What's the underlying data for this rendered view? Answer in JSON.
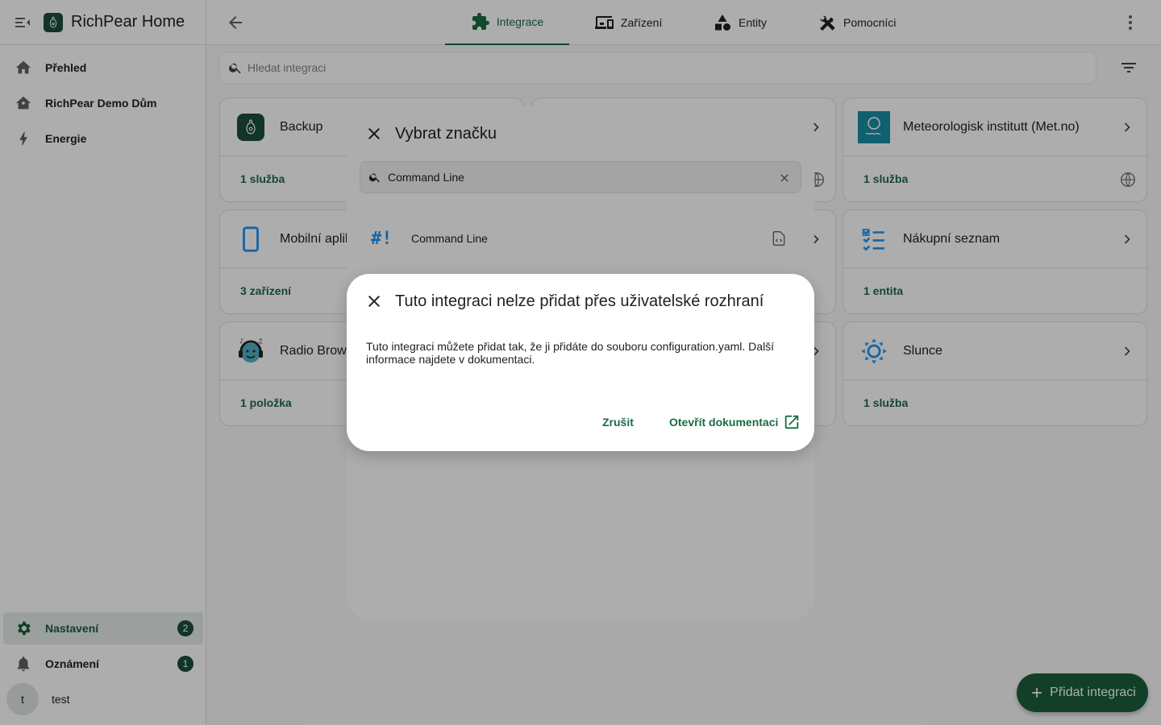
{
  "app": {
    "title": "RichPear Home"
  },
  "sidebar": {
    "items": [
      {
        "label": "Přehled",
        "icon": "home-icon"
      },
      {
        "label": "RichPear Demo Dům",
        "icon": "home-outline-icon"
      },
      {
        "label": "Energie",
        "icon": "lightning-icon"
      }
    ],
    "bottom": [
      {
        "label": "Nastavení",
        "icon": "gear-icon",
        "badge": "2"
      },
      {
        "label": "Oznámení",
        "icon": "bell-icon",
        "badge": "1"
      }
    ],
    "user": {
      "initial": "t",
      "name": "test"
    }
  },
  "tabs": [
    {
      "label": "Integrace",
      "icon": "puzzle-icon"
    },
    {
      "label": "Zařízení",
      "icon": "devices-icon"
    },
    {
      "label": "Entity",
      "icon": "shapes-icon"
    },
    {
      "label": "Pomocníci",
      "icon": "tools-icon"
    }
  ],
  "search": {
    "placeholder": "Hledat integraci"
  },
  "cards": [
    {
      "name": "Backup",
      "footer": "1 služba"
    },
    {
      "name": "Meteorologisk institutt (Met.no)",
      "footer": "1 služba"
    },
    {
      "name": "Mobilní aplikace",
      "footer": "3 zařízení"
    },
    {
      "name": "Nákupní seznam",
      "footer": "1 entita"
    },
    {
      "name": "Radio Browser",
      "footer": "1 položka"
    },
    {
      "name": "Slunce",
      "footer": "1 služba"
    }
  ],
  "fab": {
    "label": "Přidat integraci"
  },
  "brand_dialog": {
    "title": "Vybrat značku",
    "search_value": "Command Line",
    "result": {
      "symbol": "#!",
      "label": "Command Line"
    }
  },
  "info_dialog": {
    "title": "Tuto integraci nelze přidat přes uživatelské rozhraní",
    "body": "Tuto integraci můžete přidat tak, že ji přidáte do souboru configuration.yaml. Další informace najdete v dokumentaci.",
    "cancel": "Zrušit",
    "open_docs": "Otevřít dokumentaci"
  },
  "colors": {
    "accent": "#1b6b45",
    "brand_dark": "#1b4d3e",
    "metno": "#1a8ea6",
    "command_line": "#2196f3"
  }
}
